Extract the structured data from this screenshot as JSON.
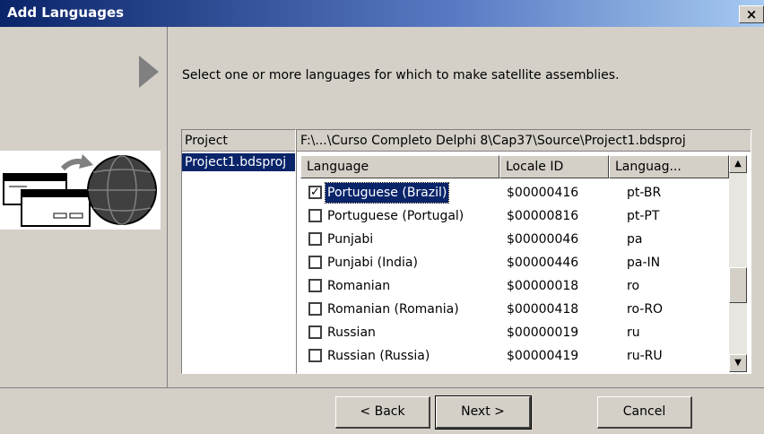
{
  "window": {
    "title": "Add Languages",
    "close_glyph": "×"
  },
  "instructions": "Select one or more languages for which to make satellite assemblies.",
  "project_list": {
    "header": "Project",
    "items": [
      "Project1.bdsproj"
    ]
  },
  "language_list": {
    "path": "F:\\...\\Curso Completo Delphi 8\\Cap37\\Source\\Project1.bdsproj",
    "columns": [
      "Language",
      "Locale ID",
      "Languag..."
    ],
    "rows": [
      {
        "language": "Portuguese (Brazil)",
        "locale_id": "$00000416",
        "code": "pt-BR",
        "checked": true,
        "selected": true
      },
      {
        "language": "Portuguese (Portugal)",
        "locale_id": "$00000816",
        "code": "pt-PT",
        "checked": false
      },
      {
        "language": "Punjabi",
        "locale_id": "$00000046",
        "code": "pa",
        "checked": false
      },
      {
        "language": "Punjabi (India)",
        "locale_id": "$00000446",
        "code": "pa-IN",
        "checked": false
      },
      {
        "language": "Romanian",
        "locale_id": "$00000018",
        "code": "ro",
        "checked": false
      },
      {
        "language": "Romanian (Romania)",
        "locale_id": "$00000418",
        "code": "ro-RO",
        "checked": false
      },
      {
        "language": "Russian",
        "locale_id": "$00000019",
        "code": "ru",
        "checked": false
      },
      {
        "language": "Russian (Russia)",
        "locale_id": "$00000419",
        "code": "ru-RU",
        "checked": false
      }
    ]
  },
  "buttons": {
    "back": "< Back",
    "next": "Next >",
    "cancel": "Cancel"
  },
  "colors": {
    "title_gradient_start": "#0a246a",
    "dialog_face": "#d4d0c8",
    "selection": "#0a246a"
  },
  "icons": {
    "close": "close-icon",
    "arrow": "wizard-arrow-icon",
    "illustration": "globe-window-illustration"
  }
}
